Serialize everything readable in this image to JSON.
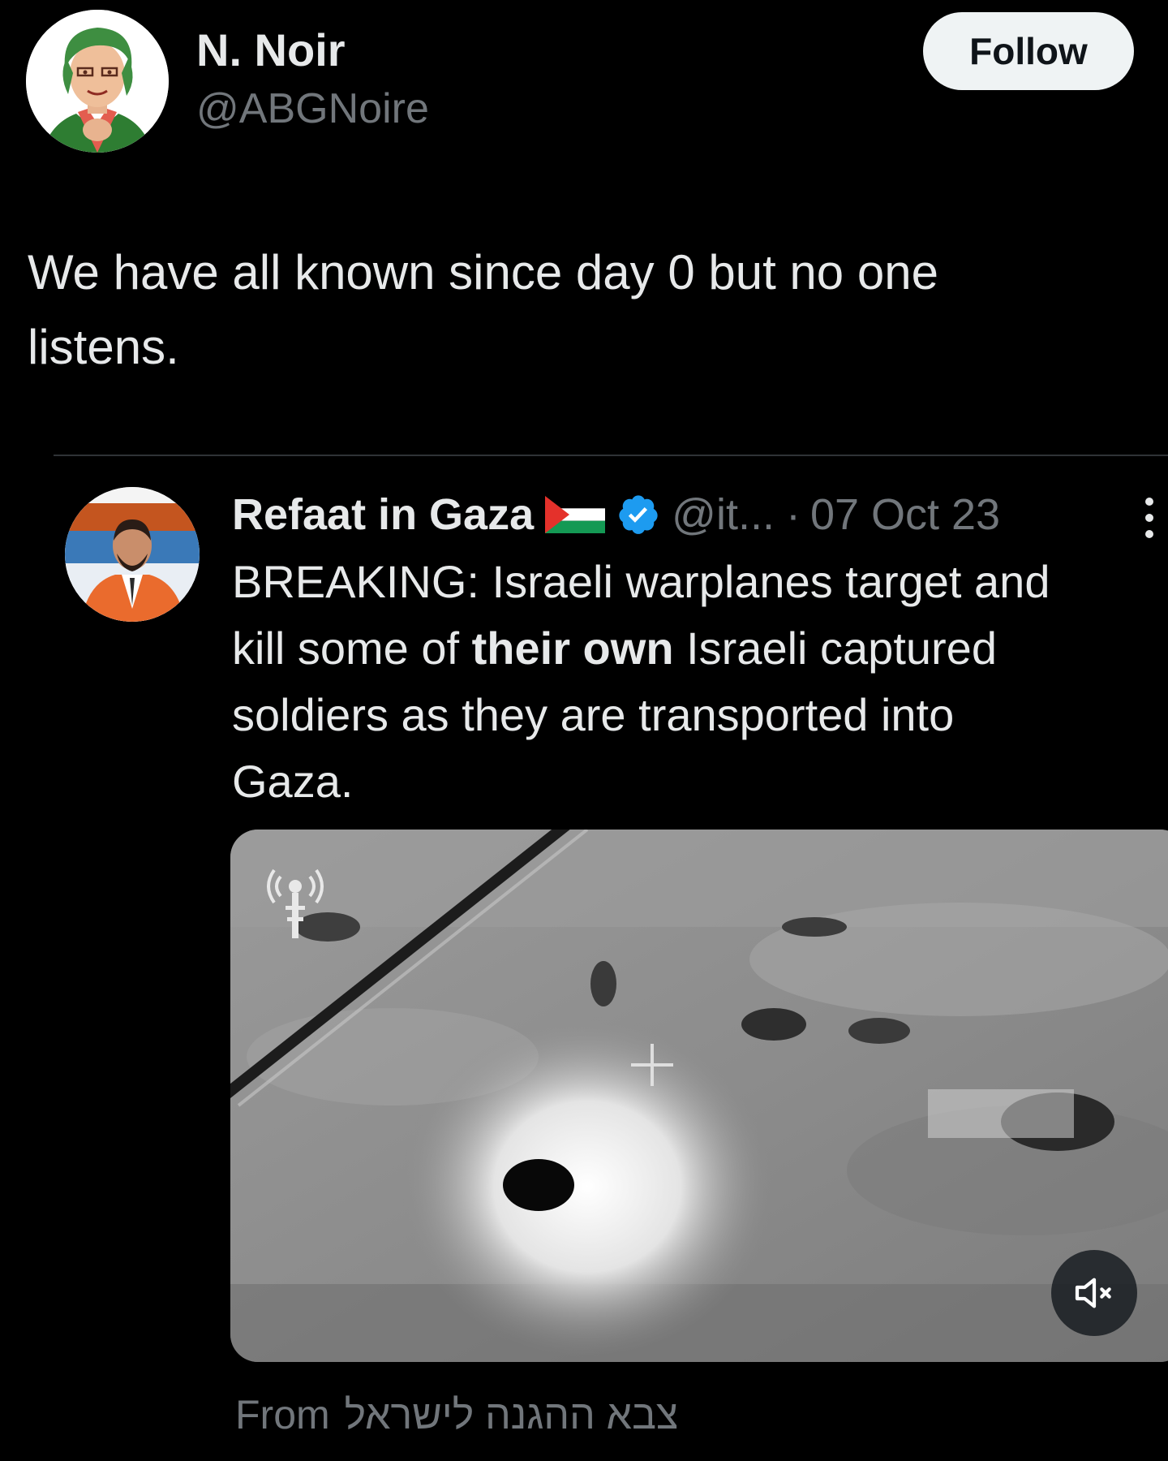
{
  "author": {
    "display_name": "N. Noir",
    "handle": "@ABGNoire",
    "avatar": "cartoon-portrait-avatar"
  },
  "follow_button": {
    "label": "Follow"
  },
  "tweet": {
    "text_line1": "We have all known since day 0 but no one",
    "text_line2": "listens."
  },
  "quoted_tweet": {
    "display_name": "Refaat in Gaza",
    "flag_icon": "palestine-flag-icon",
    "verified_icon": "verified-badge-icon",
    "handle": "@it...",
    "separator": "·",
    "date": "07 Oct 23",
    "body": {
      "line1": "BREAKING: Israeli warplanes target and",
      "line2_before": "kill some of ",
      "line2_bold": "their own",
      "line2_after": " Israeli captured",
      "line3": "soldiers as they are transported into",
      "line4": "Gaza."
    },
    "video": {
      "description_icon": "thermal-footage",
      "watermark_icon": "antenna-logo-icon",
      "mute_icon": "volume-muted-icon"
    },
    "from_label": "From",
    "from_source": "צבא ההגנה לישראל"
  },
  "colors": {
    "background": "#000000",
    "primary_text": "#e7e9ea",
    "secondary_text": "#71767b",
    "follow_bg": "#eff3f4",
    "verified_blue": "#1d9bf0",
    "divider": "#2f3336"
  }
}
